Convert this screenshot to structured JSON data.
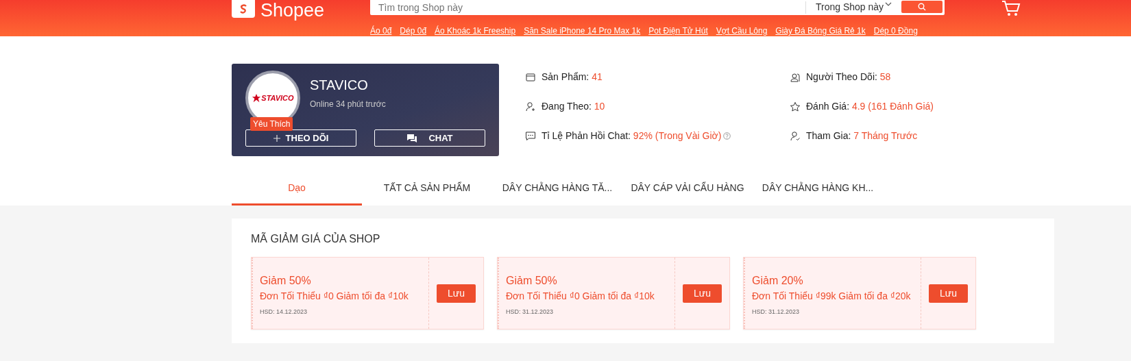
{
  "header": {
    "logo_text": "Shopee",
    "search": {
      "placeholder": "Tìm trong Shop này",
      "scope": "Trong Shop này"
    },
    "keywords": [
      "Áo 0đ",
      "Dép 0đ",
      "Áo Khoác 1k Freeship",
      "Săn Sale iPhone 14 Pro Max 1k",
      "Pot Điện Tử Hút",
      "Vợt Cầu Lông",
      "Giày Đá Bóng Giá Rẻ 1k",
      "Dép 0 Đồng"
    ]
  },
  "shop": {
    "name": "STAVICO",
    "logo_text": "STAVICO",
    "status": "Online 34 phút trước",
    "badge": "Yêu Thích",
    "follow_button": "THEO DÕI",
    "chat_button": "CHAT"
  },
  "stats": [
    {
      "kind": "store",
      "label": "Sản Phẩm:",
      "value": "41"
    },
    {
      "kind": "followers",
      "label": "Người Theo Dõi:",
      "value": "58"
    },
    {
      "kind": "following",
      "label": "Đang Theo:",
      "value": "10"
    },
    {
      "kind": "rating",
      "label": "Đánh Giá:",
      "value": "4.9 (161 Đánh Giá)"
    },
    {
      "kind": "chat",
      "label": "Tỉ Lệ Phản Hồi Chat:",
      "value": "92% (Trong Vài Giờ)",
      "help": true
    },
    {
      "kind": "joined",
      "label": "Tham Gia:",
      "value": "7 Tháng Trước"
    }
  ],
  "tabs": [
    {
      "label": "Dạo",
      "selected": true
    },
    {
      "label": "TẤT CẢ SẢN PHẨM",
      "selected": false
    },
    {
      "label": "DÂY CHẰNG HÀNG TĂ...",
      "selected": false
    },
    {
      "label": "DÂY CÁP VẢI CẨU HÀNG",
      "selected": false
    },
    {
      "label": "DÂY CHẰNG HÀNG KH...",
      "selected": false
    }
  ],
  "vouchers": {
    "title": "MÃ GIẢM GIÁ CỦA SHOP",
    "items": [
      {
        "discount": "Giảm 50%",
        "condition": "Đơn Tối Thiểu ₫0 Giảm tối đa ₫10k",
        "expiry": "HSD: 14.12.2023",
        "button": "Lưu"
      },
      {
        "discount": "Giảm 50%",
        "condition": "Đơn Tối Thiểu ₫0 Giảm tối đa ₫10k",
        "expiry": "HSD: 31.12.2023",
        "button": "Lưu"
      },
      {
        "discount": "Giảm 20%",
        "condition": "Đơn Tối Thiểu ₫99k Giảm tối đa ₫20k",
        "expiry": "HSD: 31.12.2023",
        "button": "Lưu"
      }
    ]
  }
}
